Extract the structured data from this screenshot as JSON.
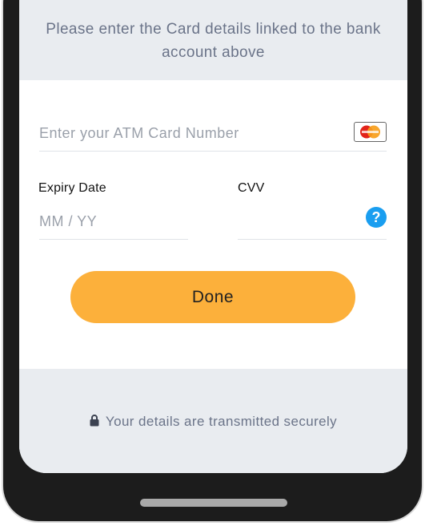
{
  "header": {
    "instruction": "Please enter the Card details linked to the bank account above"
  },
  "card_number": {
    "placeholder": "Enter your ATM Card Number",
    "value": "",
    "card_brand_icon": "mastercard-icon"
  },
  "expiry": {
    "label": "Expiry Date",
    "placeholder": "MM / YY",
    "value": ""
  },
  "cvv": {
    "label": "CVV",
    "value": "",
    "help_icon": "question-circle-icon",
    "help_symbol": "?"
  },
  "actions": {
    "done_label": "Done"
  },
  "footer": {
    "lock_icon": "lock-icon",
    "secure_text": "Your details are transmitted securely"
  },
  "colors": {
    "accent_button": "#fcb03b",
    "panel_background": "#e9ecf0",
    "help_icon": "#1a9ef0",
    "muted_text": "#6b7489"
  }
}
